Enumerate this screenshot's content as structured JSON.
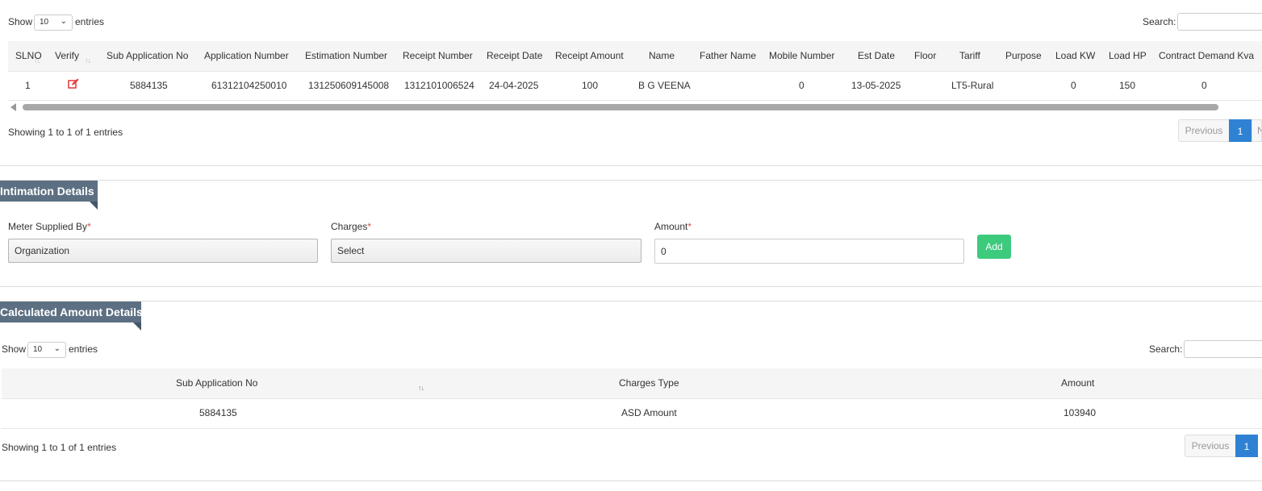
{
  "top_table": {
    "show_label": "Show",
    "entries_value": "10",
    "entries_label": "entries",
    "search_label": "Search:",
    "columns": [
      "SLNO",
      "Verify",
      "Sub Application No",
      "Application Number",
      "Estimation Number",
      "Receipt Number",
      "Receipt Date",
      "Receipt Amount",
      "Name",
      "Father Name",
      "Mobile Number",
      "Est Date",
      "Floor",
      "Tariff",
      "Purpose",
      "Load KW",
      "Load HP",
      "Contract Demand Kva"
    ],
    "row": {
      "slno": "1",
      "sub_application_no": "5884135",
      "application_number": "61312104250010",
      "estimation_number": "131250609145008",
      "receipt_number": "1312101006524",
      "receipt_date": "24-04-2025",
      "receipt_amount": "100",
      "name": "B G VEENA",
      "father_name": "",
      "mobile_number": "0",
      "est_date": "13-05-2025",
      "floor": "",
      "tariff": "LT5-Rural",
      "purpose": "",
      "load_kw": "0",
      "load_hp": "150",
      "contract_demand_kva": "0"
    },
    "info": "Showing 1 to 1 of 1 entries",
    "prev_label": "Previous",
    "page": "1",
    "next_label": "N"
  },
  "intimation": {
    "title": "Intimation Details",
    "meter_label": "Meter Supplied By",
    "meter_value": "Organization",
    "charges_label": "Charges",
    "charges_value": "Select",
    "amount_label": "Amount",
    "amount_value": "0",
    "required_mark": "*",
    "add_label": "Add"
  },
  "calc": {
    "title": "Calculated Amount Details",
    "show_label": "Show",
    "entries_value": "10",
    "entries_label": "entries",
    "search_label": "Search:",
    "columns": [
      "Sub Application No",
      "Charges Type",
      "Amount"
    ],
    "row": {
      "sub_application_no": "5884135",
      "charges_type": "ASD Amount",
      "amount": "103940"
    },
    "info": "Showing 1 to 1 of 1 entries",
    "prev_label": "Previous",
    "page": "1"
  },
  "icons": {
    "edit": "edit-icon",
    "sort": "sort-icon",
    "chevron": "chevron-down-icon",
    "scroll_left": "scroll-left-arrow-icon"
  }
}
